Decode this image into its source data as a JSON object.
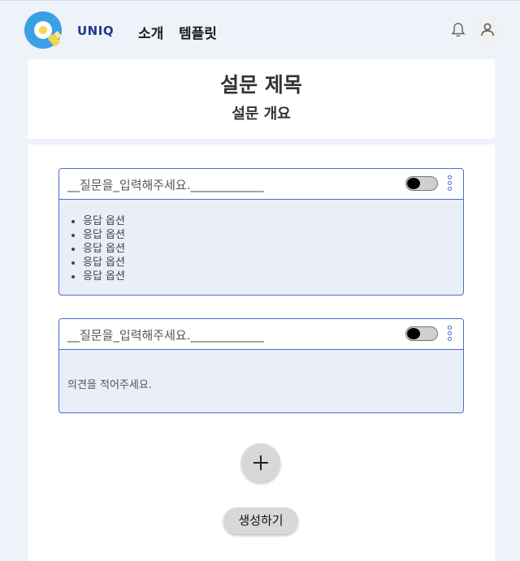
{
  "header": {
    "brand": "UNIQ",
    "nav": [
      "소개",
      "템플릿"
    ],
    "bell_icon": "bell-icon",
    "avatar_icon": "user-icon"
  },
  "survey": {
    "title": "설문 제목",
    "subtitle": "설문 개요"
  },
  "questions": [
    {
      "input_text": "__질문을_입력해주세요.____________",
      "options": [
        "응답 옵션",
        "응답 옵션",
        "응답 옵션",
        "응답 옵션",
        "응답 옵션"
      ]
    },
    {
      "input_text": "__질문을_입력해주세요.____________",
      "placeholder": "의견을 적어주세요."
    }
  ],
  "actions": {
    "add_icon": "plus-icon",
    "create_label": "생성하기"
  },
  "colors": {
    "accent": "#4a6bd6",
    "brand": "#1f3b8a",
    "background": "#eef3fa",
    "option_panel": "#e9eef7",
    "logo_blue": "#3aa0e6",
    "logo_yellow": "#f5d64a"
  }
}
